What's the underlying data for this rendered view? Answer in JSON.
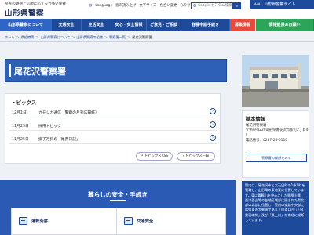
{
  "header": {
    "tagline": "県民の期待と信頼に応える力強い警察",
    "site_name": "山形県警察",
    "util_links": [
      "Language",
      "音声読み上げ",
      "文字サイズ・色合い変更",
      "ふりがなON"
    ],
    "search_placeholder": "Google カスタム検索",
    "search_button_icon": "search-icon",
    "police_site_label": "山形県警察サイト",
    "police_site_mark": "AAA"
  },
  "nav": [
    {
      "label": "山形県警察について"
    },
    {
      "label": "交通安全"
    },
    {
      "label": "生活安全"
    },
    {
      "label": "安心・安全情報"
    },
    {
      "label": "ご意見・ご相談"
    },
    {
      "label": "各種申請手続き"
    },
    {
      "label": "募集情報"
    },
    {
      "label": "情報提供のお願い"
    }
  ],
  "breadcrumb": [
    "ホーム",
    "県組織等",
    "山形県警察について",
    "山形県警察の組織",
    "警察署一覧",
    "尾花沢警察署"
  ],
  "page_title": "尾花沢警察署",
  "topics": {
    "heading": "トピックス",
    "items": [
      {
        "date": "12月1日",
        "text": "カモシカ通信（警察の月刊広報紙）"
      },
      {
        "date": "11月25日",
        "text": "採用トピック"
      },
      {
        "date": "11月25日",
        "text": "振子万負の「尾荒日記」"
      }
    ],
    "rss_label": "トピックスRSS",
    "list_label": "トピックス一覧"
  },
  "basic_info": {
    "heading": "基本情報",
    "name": "尾花沢警察署",
    "postal": "〒999-4229山形県尾花沢市新町2丁目4-1",
    "phone": "電話番号：0237-24-0110",
    "link_label": "警察署の様所をみる"
  },
  "side_description": "警内は、尾花沢市と大石田町の1市1町を管轄し、山形県の東北東に位置しています。東は舞鶴山を中心とした興厚山麓、西は西山等の台地区域部に囲まれた県北部の北部に位置し、警内の道路中央部には県東の大動脈である「国道13号」「JR奥羽本線」及び「最上川」が南北に縦断しています。",
  "safety": {
    "heading": "暮らしの安全・手続き",
    "cards": [
      {
        "label": "運転免許"
      },
      {
        "label": "交通安全"
      }
    ]
  },
  "colors": {
    "brand": "#1e4a9c",
    "accent_red": "#e84a3c",
    "accent_green": "#2ca55a"
  }
}
